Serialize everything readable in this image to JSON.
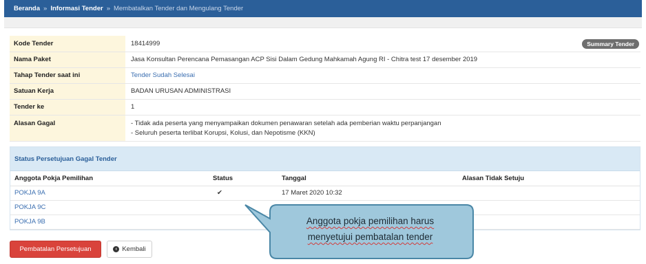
{
  "breadcrumb": {
    "items": [
      "Beranda",
      "Informasi Tender",
      "Membatalkan Tender dan Mengulang Tender"
    ],
    "separator": "»"
  },
  "info": {
    "rows": [
      {
        "label": "Kode Tender",
        "value": "18414999"
      },
      {
        "label": "Nama Paket",
        "value": "Jasa Konsultan Perencana Pemasangan ACP Sisi Dalam Gedung Mahkamah Agung RI - Chitra test 17 desember 2019"
      },
      {
        "label": "Tahap Tender saat ini",
        "value": "Tender Sudah Selesai"
      },
      {
        "label": "Satuan Kerja",
        "value": "BADAN URUSAN ADMINISTRASI"
      },
      {
        "label": "Tender ke",
        "value": "1"
      },
      {
        "label": "Alasan Gagal",
        "line1": "- Tidak ada peserta yang menyampaikan dokumen penawaran setelah ada pemberian waktu perpanjangan",
        "line2": "- Seluruh peserta terlibat Korupsi, Kolusi, dan Nepotisme (KKN)"
      }
    ],
    "summary_badge": "Summary Tender"
  },
  "approval": {
    "title": "Status Persetujuan Gagal Tender",
    "columns": [
      "Anggota Pokja Pemilihan",
      "Status",
      "Tanggal",
      "Alasan Tidak Setuju"
    ],
    "rows": [
      {
        "member": "POKJA 9A",
        "status": "✔",
        "date": "17 Maret 2020 10:32",
        "reason": ""
      },
      {
        "member": "POKJA 9C",
        "status": "",
        "date": "",
        "reason": ""
      },
      {
        "member": "POKJA 9B",
        "status": "",
        "date": "",
        "reason": ""
      }
    ]
  },
  "actions": {
    "cancel_label": "Pembatalan Persetujuan",
    "back_label": "Kembali",
    "back_icon": "circle-arrow-left-icon"
  },
  "callout": {
    "line1": "Anggota pokja pemilihan harus",
    "line2": "menyetujui pembatalan tender"
  },
  "colors": {
    "header_blue": "#2b5f99",
    "label_bg": "#fdf6dd",
    "panel_head_bg": "#d9e9f5",
    "danger": "#d9433b",
    "callout_fill": "#9fc8dc",
    "callout_border": "#4a87a6"
  }
}
